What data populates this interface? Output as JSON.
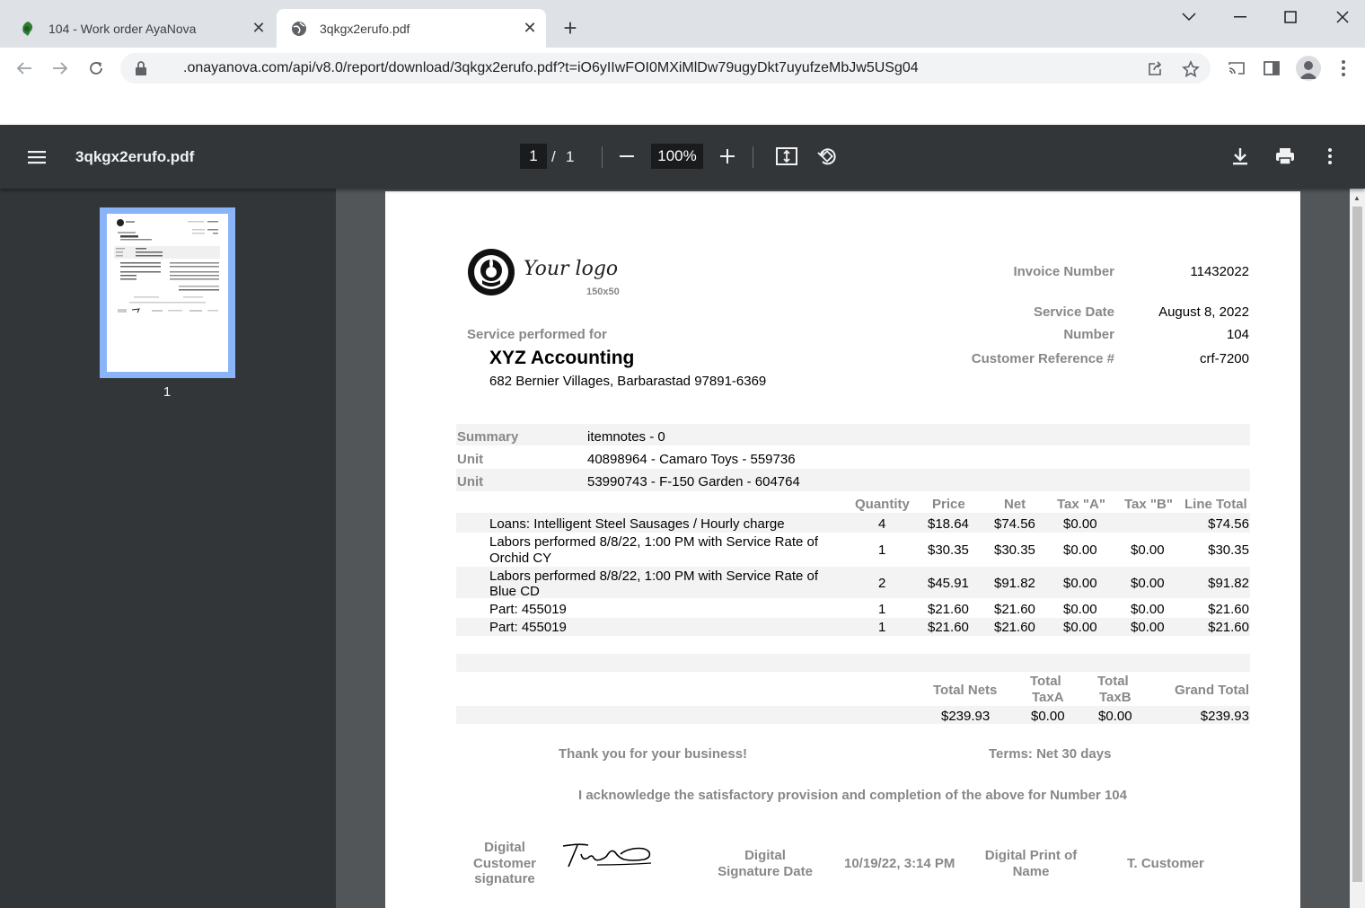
{
  "browser": {
    "tabs": [
      {
        "title": "104 - Work order AyaNova"
      },
      {
        "title": "3qkgx2erufo.pdf"
      }
    ],
    "url": ".onayanova.com/api/v8.0/report/download/3qkgx2erufo.pdf?t=iO6yIIwFOI0MXiMlDw79ugyDkt7uyufzeMbJw5USg04"
  },
  "pdf": {
    "filename": "3qkgx2erufo.pdf",
    "page_current": "1",
    "page_sep": "/",
    "page_total": "1",
    "zoom": "100%",
    "thumb_label": "1"
  },
  "invoice": {
    "logo_text": "Your logo",
    "logo_size": "150x50",
    "fields": [
      {
        "label": "Invoice Number",
        "value": "11432022"
      },
      {
        "label": "Service Date",
        "value": "August 8, 2022"
      },
      {
        "label": "Number",
        "value": "104"
      },
      {
        "label": "Customer Reference #",
        "value": "crf-7200"
      }
    ],
    "service_for_label": "Service performed for",
    "customer_name": "XYZ Accounting",
    "customer_address": "682 Bernier Villages, Barbarastad 97891-6369",
    "summary_rows": [
      {
        "label": "Summary",
        "value": "itemnotes - 0"
      },
      {
        "label": "Unit",
        "value": "40898964 - Camaro Toys - 559736"
      },
      {
        "label": "Unit",
        "value": "53990743 - F-150 Garden - 604764"
      }
    ],
    "columns": [
      "Quantity",
      "Price",
      "Net",
      "Tax \"A\"",
      "Tax \"B\"",
      "Line Total"
    ],
    "items": [
      {
        "desc1": "Loans: Intelligent Steel Sausages / Hourly charge",
        "desc2": "",
        "qty": "4",
        "price": "$18.64",
        "net": "$74.56",
        "taxa": "$0.00",
        "taxb": "",
        "total": "$74.56"
      },
      {
        "desc1": "Labors performed 8/8/22, 1:00 PM with Service Rate of",
        "desc2": "Orchid CY",
        "qty": "1",
        "price": "$30.35",
        "net": "$30.35",
        "taxa": "$0.00",
        "taxb": "$0.00",
        "total": "$30.35"
      },
      {
        "desc1": "Labors performed 8/8/22, 1:00 PM with Service Rate of",
        "desc2": "Blue CD",
        "qty": "2",
        "price": "$45.91",
        "net": "$91.82",
        "taxa": "$0.00",
        "taxb": "$0.00",
        "total": "$91.82"
      },
      {
        "desc1": "Part: 455019",
        "desc2": "",
        "qty": "1",
        "price": "$21.60",
        "net": "$21.60",
        "taxa": "$0.00",
        "taxb": "$0.00",
        "total": "$21.60"
      },
      {
        "desc1": "Part: 455019",
        "desc2": "",
        "qty": "1",
        "price": "$21.60",
        "net": "$21.60",
        "taxa": "$0.00",
        "taxb": "$0.00",
        "total": "$21.60"
      }
    ],
    "totals": {
      "nets_label": "Total Nets",
      "taxa_label1": "Total",
      "taxa_label2": "TaxA",
      "taxb_label1": "Total",
      "taxb_label2": "TaxB",
      "grand_label": "Grand Total",
      "nets": "$239.93",
      "taxa": "$0.00",
      "taxb": "$0.00",
      "grand": "$239.93"
    },
    "thanks": "Thank you for your business!",
    "terms": "Terms: Net 30 days",
    "acknowledge": "I acknowledge the satisfactory provision and completion of the above for Number 104",
    "sig_label": [
      "Digital",
      "Customer",
      "signature"
    ],
    "sig_date_label": [
      "Digital",
      "Signature Date"
    ],
    "sig_date": "10/19/22, 3:14 PM",
    "print_name_label": [
      "Digital Print of",
      "Name"
    ],
    "print_name": "T. Customer"
  }
}
